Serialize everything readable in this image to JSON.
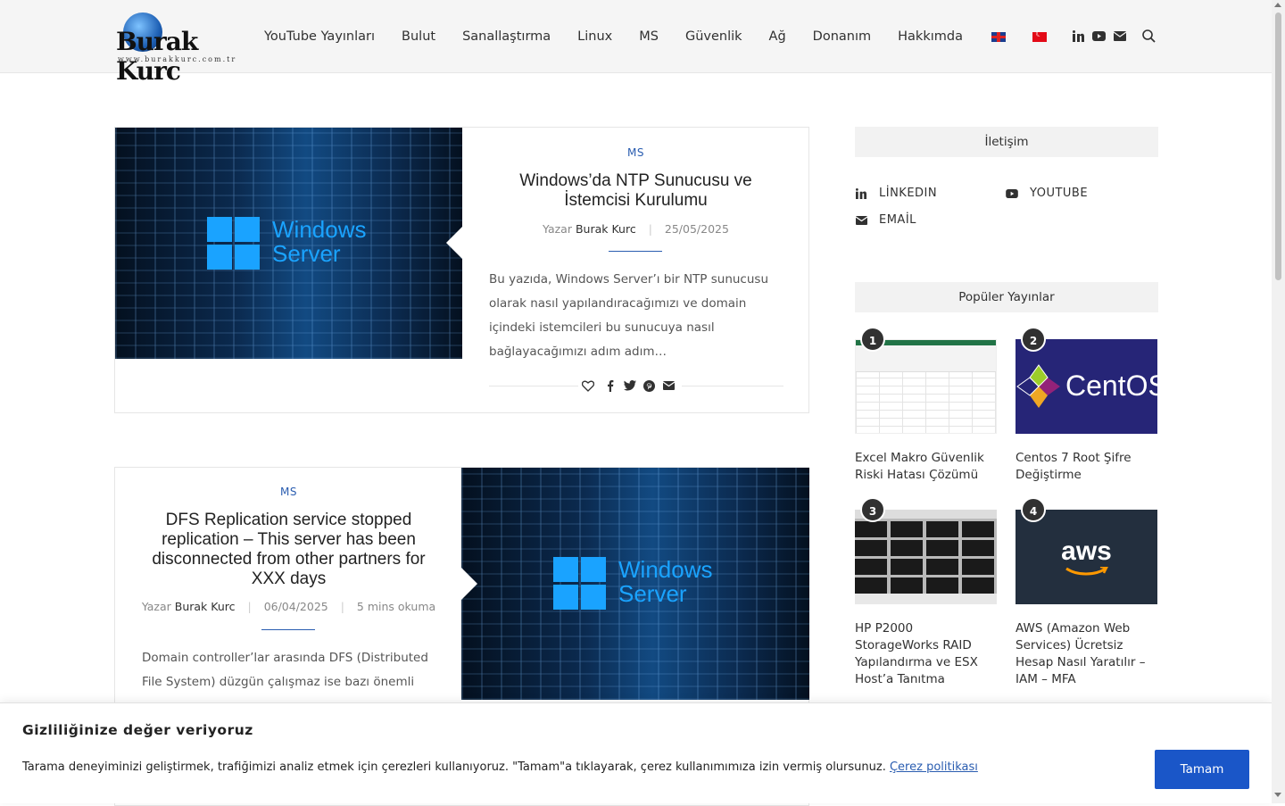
{
  "site": {
    "logo_text": "Burak Kurc",
    "logo_url_text": "www.burakkurc.com.tr"
  },
  "nav": {
    "items": [
      "YouTube Yayınları",
      "Bulut",
      "Sanallaştırma",
      "Linux",
      "MS",
      "Güvenlik",
      "Ağ",
      "Donanım",
      "Hakkımda"
    ]
  },
  "posts": [
    {
      "category": "MS",
      "title": "Windows’da NTP Sunucusu ve İstemcisi Kurulumu",
      "author_prefix": "Yazar",
      "author": "Burak Kurc",
      "date": "25/05/2025",
      "excerpt": "Bu yazıda, Windows Server’ı bir NTP sunucusu olarak nasıl yapılandıracağımızı ve domain içindeki istemcileri bu sunucuya nasıl bağlayacağımızı adım adım…",
      "thumb_title": "Windows",
      "thumb_subtitle": "Server"
    },
    {
      "category": "MS",
      "title": "DFS Replication service stopped replication – This server has been disconnected from other partners for XXX days",
      "author_prefix": "Yazar",
      "author": "Burak Kurc",
      "date": "06/04/2025",
      "read_time": "5 mins okuma",
      "excerpt": "Domain controller’lar arasında DFS (Distributed File System) düzgün çalışmaz ise bazı önemli",
      "thumb_title": "Windows",
      "thumb_subtitle": "Server"
    }
  ],
  "sidebar": {
    "contact_title": "İletişim",
    "social": [
      {
        "label": "LİNKEDIN",
        "icon": "linkedin-icon"
      },
      {
        "label": "YOUTUBE",
        "icon": "youtube-icon"
      },
      {
        "label": "EMAİL",
        "icon": "envelope-icon"
      }
    ],
    "popular_title": "Popüler Yayınlar",
    "popular": [
      {
        "rank": "1",
        "title": "Excel Makro Güvenlik Riski Hatası Çözümü"
      },
      {
        "rank": "2",
        "title": "Centos 7 Root Şifre Değiştirme",
        "thumb_text": "CentOS"
      },
      {
        "rank": "3",
        "title": "HP P2000 StorageWorks RAID Yapılandırma ve ESX Host’a Tanıtma"
      },
      {
        "rank": "4",
        "title": "AWS (Amazon Web Services) Ücretsiz Hesap Nasıl Yaratılır – IAM – MFA",
        "thumb_text": "aws"
      }
    ]
  },
  "cookie": {
    "title": "Gizliliğinize değer veriyoruz",
    "text": "Tarama deneyiminizi geliştirmek, trafiğimizi analiz etmek için çerezleri kullanıyoruz. \"Tamam\"a tıklayarak, çerez kullanımımıza izin vermiş olursunuz.",
    "link": "Çerez politikası",
    "button": "Tamam"
  },
  "colors": {
    "accent": "#2a5db0",
    "button": "#1a56c8",
    "header_bg": "#f5f5f5"
  }
}
